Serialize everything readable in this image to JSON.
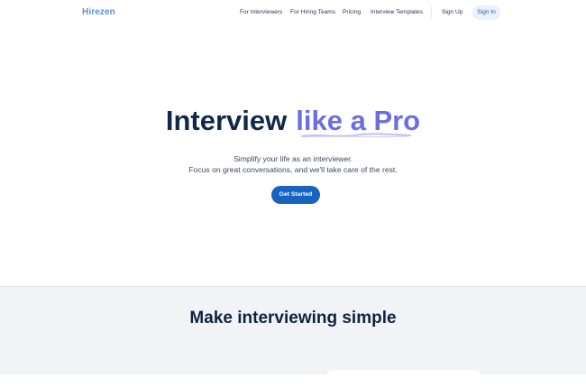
{
  "nav": {
    "logo": "Hirezen",
    "links": [
      "For Interviewers",
      "For Hiring Teams",
      "Pricing",
      "Interview Templates"
    ],
    "signup": "Sign Up",
    "signin": "Sign In"
  },
  "hero": {
    "title_part1": "Interview",
    "title_part2": "like a Pro",
    "subtitle_line1": "Simplify your life as an interviewer.",
    "subtitle_line2": "Focus on great conversations, and we'll take care of the rest.",
    "cta": "Get Started"
  },
  "section2": {
    "title": "Make interviewing simple"
  },
  "colors": {
    "brand": "#5a8fdc",
    "accent": "#6b6fe0",
    "primary_button": "#1763c0",
    "heading": "#12284a"
  }
}
